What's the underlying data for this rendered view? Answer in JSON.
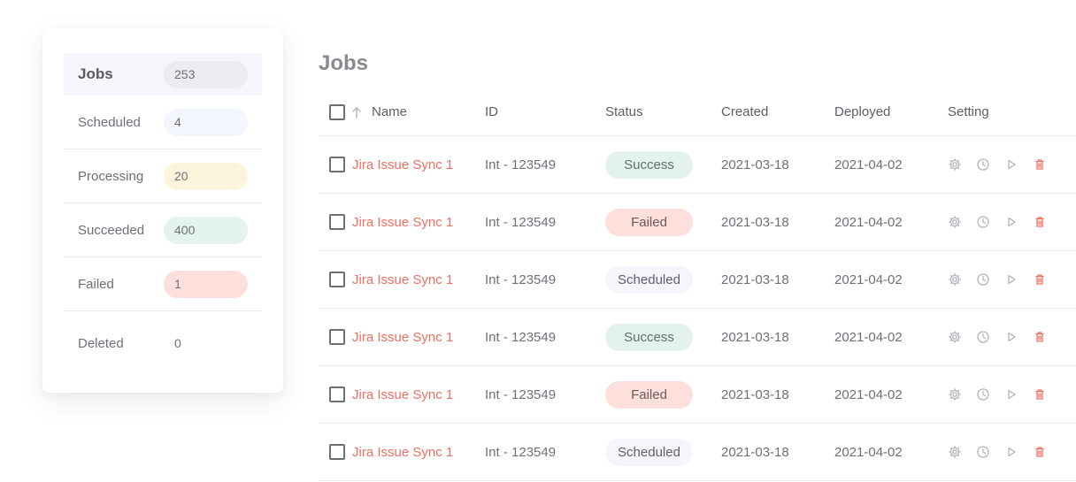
{
  "sidebar": {
    "items": [
      {
        "label": "Jobs",
        "count": "253",
        "pill_color": "#ebebf0"
      },
      {
        "label": "Scheduled",
        "count": "4",
        "pill_color": "#f4f6fd"
      },
      {
        "label": "Processing",
        "count": "20",
        "pill_color": "#fdf4dd"
      },
      {
        "label": "Succeeded",
        "count": "400",
        "pill_color": "#e4f3ec"
      },
      {
        "label": "Failed",
        "count": "1",
        "pill_color": "#fde0dc"
      },
      {
        "label": "Deleted",
        "count": "0",
        "pill_color": "transparent"
      }
    ]
  },
  "main": {
    "title": "Jobs",
    "columns": [
      "Name",
      "ID",
      "Status",
      "Created",
      "Deployed",
      "Setting"
    ],
    "rows": [
      {
        "name": "Jira Issue Sync 1",
        "id": "Int - 123549",
        "status": "Success",
        "status_kind": "success",
        "created": "2021-03-18",
        "deployed": "2021-04-02"
      },
      {
        "name": "Jira Issue Sync 1",
        "id": "Int - 123549",
        "status": "Failed",
        "status_kind": "failed",
        "created": "2021-03-18",
        "deployed": "2021-04-02"
      },
      {
        "name": "Jira Issue Sync 1",
        "id": "Int - 123549",
        "status": "Scheduled",
        "status_kind": "scheduled",
        "created": "2021-03-18",
        "deployed": "2021-04-02"
      },
      {
        "name": "Jira Issue Sync 1",
        "id": "Int - 123549",
        "status": "Success",
        "status_kind": "success",
        "created": "2021-03-18",
        "deployed": "2021-04-02"
      },
      {
        "name": "Jira Issue Sync 1",
        "id": "Int - 123549",
        "status": "Failed",
        "status_kind": "failed",
        "created": "2021-03-18",
        "deployed": "2021-04-02"
      },
      {
        "name": "Jira Issue Sync 1",
        "id": "Int - 123549",
        "status": "Scheduled",
        "status_kind": "scheduled",
        "created": "2021-03-18",
        "deployed": "2021-04-02"
      }
    ],
    "row_actions": [
      "gear-icon",
      "clock-icon",
      "play-icon",
      "trash-icon"
    ]
  },
  "colors": {
    "accent": "#f07062",
    "delete": "#f07062",
    "icon": "#b4b4bc"
  }
}
